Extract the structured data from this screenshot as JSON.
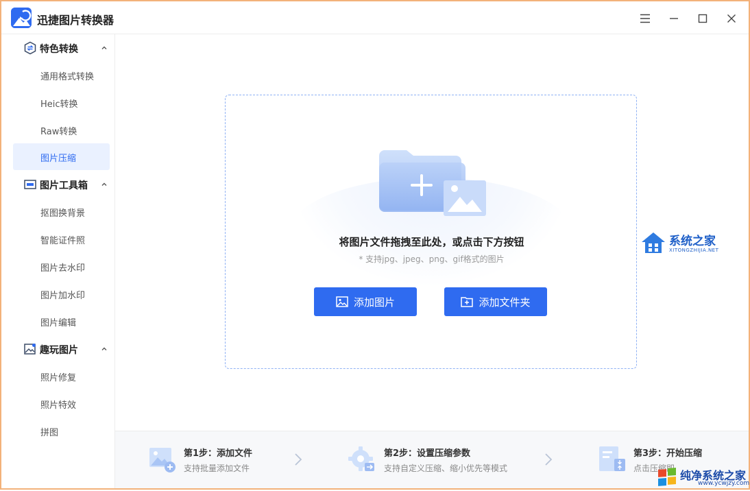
{
  "app": {
    "title": "迅捷图片转换器",
    "accent_color": "#2f6bf0"
  },
  "window_controls": {
    "menu_icon": "hamburger-menu-icon",
    "minimize_icon": "minimize-icon",
    "maximize_icon": "maximize-icon",
    "close_icon": "close-icon"
  },
  "sidebar": {
    "groups": [
      {
        "label": "特色转换",
        "icon": "convert-icon",
        "items": [
          {
            "label": "通用格式转换"
          },
          {
            "label": "Heic转换"
          },
          {
            "label": "Raw转换"
          },
          {
            "label": "图片压缩",
            "active": true
          }
        ]
      },
      {
        "label": "图片工具箱",
        "icon": "toolbox-icon",
        "items": [
          {
            "label": "抠图换背景"
          },
          {
            "label": "智能证件照"
          },
          {
            "label": "图片去水印"
          },
          {
            "label": "图片加水印"
          },
          {
            "label": "图片编辑"
          }
        ]
      },
      {
        "label": "趣玩图片",
        "icon": "fun-image-icon",
        "items": [
          {
            "label": "照片修复"
          },
          {
            "label": "照片特效"
          },
          {
            "label": "拼图"
          }
        ]
      }
    ]
  },
  "dropzone": {
    "title": "将图片文件拖拽至此处，或点击下方按钮",
    "subtitle": "* 支持jpg、jpeg、png、gif格式的图片",
    "add_image_label": "添加图片",
    "add_folder_label": "添加文件夹"
  },
  "steps": [
    {
      "title": "第1步：添加文件",
      "desc": "支持批量添加文件",
      "icon": "add-image-step-icon"
    },
    {
      "title": "第2步：设置压缩参数",
      "desc": "支持自定义压缩、缩小优先等模式",
      "icon": "settings-step-icon"
    },
    {
      "title": "第3步：开始压缩",
      "desc": "点击压缩即可完成压缩",
      "icon": "compress-step-icon"
    }
  ],
  "watermarks": {
    "top": {
      "title": "系统之家",
      "sub": "XITONGZHIJIA.NET"
    },
    "bottom": {
      "title": "纯净系统之家",
      "sub": "www.ycwjzy.com"
    }
  }
}
